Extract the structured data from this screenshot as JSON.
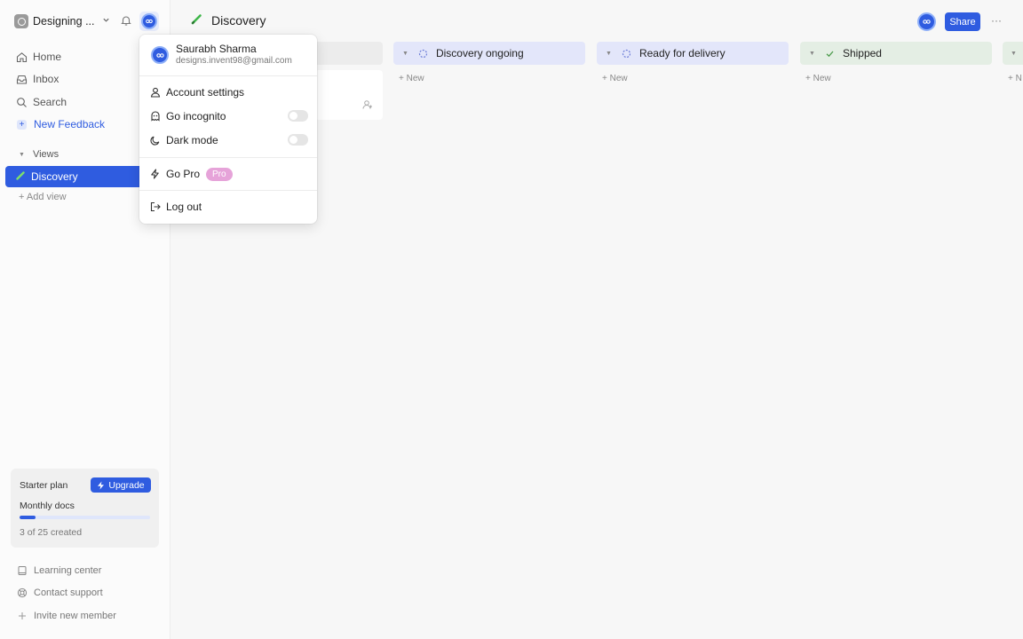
{
  "sidebar": {
    "workspace_name": "Designing ...",
    "nav": {
      "home": "Home",
      "inbox": "Inbox",
      "search": "Search",
      "new_feedback": "New Feedback"
    },
    "views_label": "Views",
    "active_view": "Discovery",
    "add_view": "+ Add view",
    "plan": {
      "title": "Starter plan",
      "upgrade_label": "Upgrade",
      "docs_label": "Monthly docs",
      "docs_created": 3,
      "docs_limit": 25,
      "docs_progress_fraction": 0.12,
      "created_text": "3 of 25 created"
    },
    "footer": {
      "learning_center": "Learning center",
      "contact_support": "Contact support",
      "invite_member": "Invite new member"
    }
  },
  "header": {
    "title": "Discovery",
    "share_label": "Share",
    "more_label": "···"
  },
  "board": {
    "columns": [
      {
        "name": "Discovery ongoing",
        "status_icon": "dashed-circle-icon",
        "color": "#e3e6fa",
        "new_label": "+ New"
      },
      {
        "name": "Ready for delivery",
        "status_icon": "dashed-circle-icon",
        "color": "#e3e6fa",
        "new_label": "+ New"
      },
      {
        "name": "Shipped",
        "status_icon": "check-icon",
        "color": "#e4eee4",
        "new_label": "+ New"
      },
      {
        "name": "",
        "status_icon": "",
        "color": "#e4eee4",
        "new_label": "+ N"
      }
    ]
  },
  "user_menu": {
    "name": "Saurabh Sharma",
    "email": "designs.invent98@gmail.com",
    "account_settings": "Account settings",
    "go_incognito": "Go incognito",
    "incognito_on": false,
    "dark_mode": "Dark mode",
    "dark_mode_on": false,
    "go_pro": "Go Pro",
    "pro_badge": "Pro",
    "log_out": "Log out"
  },
  "colors": {
    "accent": "#2f5ce0",
    "pro_badge": "#e6a3d9"
  }
}
